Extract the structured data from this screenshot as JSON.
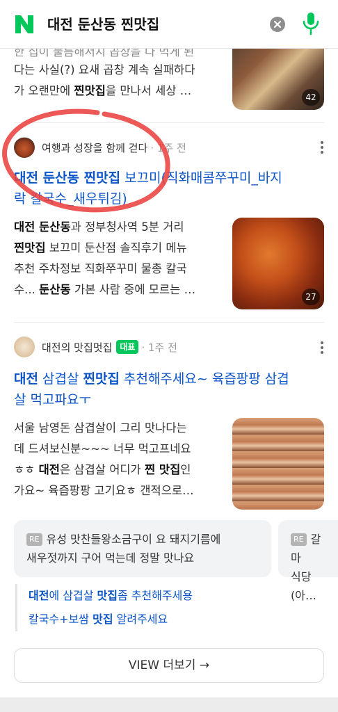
{
  "header": {
    "logo": "N",
    "query": "대전 둔산동 찐맛집",
    "clear_icon": "clear-icon",
    "mic_icon": "mic-icon",
    "brand_color": "#03c75a"
  },
  "post1": {
    "line0": "한 집이 물름해서지 곱장을 다 먹게 된",
    "line1": "다는 사실(?) 요새 곱창 계속 실패하다",
    "line2_a": "가 오랜만에 ",
    "line2_b": "찐맛집",
    "line2_c": "을 만나서 세상 …",
    "image_count": "42"
  },
  "post2": {
    "author": "여행과 성장을 함께 걷다",
    "ago": "· 1주 전",
    "title_a": "대전 둔산동 찐맛집",
    "title_b": " 보끄미(직화매콤쭈꾸미_바지",
    "title_c": "락 칼국수_새우튀김)",
    "l1_a": "대전 둔산동",
    "l1_b": "과 정부청사역 5분 거리",
    "l2_a": "찐맛집",
    "l2_b": " 보끄미 둔산점 솔직후기 메뉴",
    "l3": "추천 주차정보 직화쭈꾸미 물총 칼국",
    "l4_a": "수... ",
    "l4_b": "둔산동",
    "l4_c": " 가본 사람 중에 모르는 …",
    "image_count": "27"
  },
  "post3": {
    "author": "대전의 맛집멋집",
    "badge": "대표",
    "ago": "· 1주 전",
    "t1_a": "대전",
    "t1_b": " 삼겹살 ",
    "t1_c": "찐맛집",
    "t1_d": " 추천해주세요~ 육즙팡팡 삼겹",
    "t2": "살 먹고파요ㅜ",
    "l1": "서울 남영돈 삼겹살이 그리 맛나다는",
    "l2": "데 드셔보신분~~~ 너무 먹고프네요",
    "l3_a": "ㅎㅎ ",
    "l3_b": "대전",
    "l3_c": "은 삼겹살 어디가 ",
    "l3_d": "찐 맛집",
    "l3_e": "인",
    "l4": "가요~ 육즙팡팡 고기요ㅎ 갠적으로…",
    "card1_re": "RE",
    "card1_l1": "유성 맛찬들왕소금구이 요 돼지기름에",
    "card1_l2": "새우젓까지 구어 먹는데 정말 맛나요",
    "card2_re": "RE",
    "card2_l1": "갈마",
    "card2_l2": "식당 (아…",
    "link1_a": "대전",
    "link1_b": "에 삼겹살 ",
    "link1_c": "맛집",
    "link1_d": "좀 추천해주세용",
    "link2_a": "칼국수+보쌈 ",
    "link2_b": "맛집",
    "link2_c": " 알려주세요"
  },
  "view_more": "VIEW 더보기 →",
  "colors": {
    "link": "#0b55c8",
    "annotation": "#e9423f"
  }
}
